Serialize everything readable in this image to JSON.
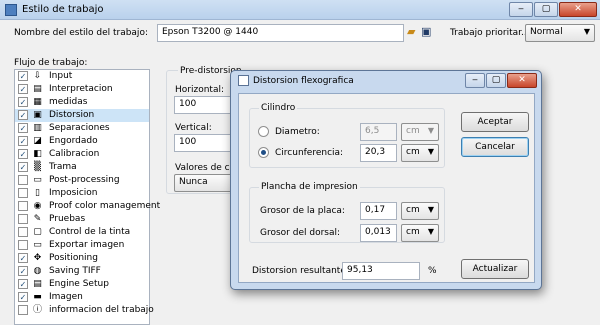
{
  "window": {
    "title": "Estilo de trabajo"
  },
  "header": {
    "style_name_label": "Nombre del estilo del trabajo:",
    "style_name_value": "Epson T3200 @ 1440",
    "priority_label": "Trabajo prioritar...",
    "priority_value": "Normal"
  },
  "workflow": {
    "label": "Flujo de trabajo:",
    "items": [
      {
        "label": "Input",
        "checked": true,
        "icon": "input-icon",
        "glyph": "⇩"
      },
      {
        "label": "Interpretacion",
        "checked": true,
        "icon": "interpretation-icon",
        "glyph": "▤"
      },
      {
        "label": "medidas",
        "checked": true,
        "icon": "measure-icon",
        "glyph": "▦"
      },
      {
        "label": "Distorsion",
        "checked": true,
        "icon": "distortion-icon",
        "glyph": "▣",
        "selected": true
      },
      {
        "label": "Separaciones",
        "checked": true,
        "icon": "separations-icon",
        "glyph": "▥"
      },
      {
        "label": "Engordado",
        "checked": true,
        "icon": "gain-icon",
        "glyph": "◪"
      },
      {
        "label": "Calibracion",
        "checked": true,
        "icon": "calibration-icon",
        "glyph": "◧"
      },
      {
        "label": "Trama",
        "checked": true,
        "icon": "screening-icon",
        "glyph": "▒"
      },
      {
        "label": "Post-processing",
        "checked": false,
        "icon": "post-processing-icon",
        "glyph": "▭"
      },
      {
        "label": "Imposicion",
        "checked": false,
        "icon": "imposition-icon",
        "glyph": "▯"
      },
      {
        "label": "Proof color management",
        "checked": false,
        "icon": "proof-color-icon",
        "glyph": "◉"
      },
      {
        "label": "Pruebas",
        "checked": false,
        "icon": "proofs-icon",
        "glyph": "✎"
      },
      {
        "label": "Control de la tinta",
        "checked": false,
        "icon": "ink-control-icon",
        "glyph": "▢"
      },
      {
        "label": "Exportar imagen",
        "checked": false,
        "icon": "export-image-icon",
        "glyph": "▭"
      },
      {
        "label": "Positioning",
        "checked": true,
        "icon": "positioning-icon",
        "glyph": "✥"
      },
      {
        "label": "Saving TIFF",
        "checked": true,
        "icon": "saving-tiff-icon",
        "glyph": "◍"
      },
      {
        "label": "Engine Setup",
        "checked": true,
        "icon": "engine-setup-icon",
        "glyph": "▤"
      },
      {
        "label": "Imagen",
        "checked": true,
        "icon": "image-icon",
        "glyph": "▬"
      },
      {
        "label": "informacion del trabajo",
        "checked": false,
        "icon": "info-icon",
        "glyph": "ⓘ"
      }
    ]
  },
  "predistortion": {
    "group_label": "Pre-distorsion",
    "horizontal_label": "Horizontal:",
    "horizontal_value": "100",
    "vertical_label": "Vertical:",
    "vertical_value": "100",
    "values_label": "Valores de ca",
    "values_select": "Nunca"
  },
  "dialog": {
    "title": "Distorsion flexografica",
    "cylinder_group": "Cilindro",
    "diameter_label": "Diametro:",
    "diameter_value": "6,5",
    "diameter_unit": "cm",
    "circumference_label": "Circunferencia:",
    "circumference_value": "20,3",
    "circumference_unit": "cm",
    "plate_group": "Plancha de impresion",
    "plate_thickness_label": "Grosor de la placa:",
    "plate_thickness_value": "0,17",
    "plate_thickness_unit": "cm",
    "backing_thickness_label": "Grosor del dorsal:",
    "backing_thickness_value": "0,013",
    "backing_thickness_unit": "cm",
    "result_label": "Distorsion resultante:",
    "result_value": "95,13",
    "result_unit": "%",
    "accept_button": "Aceptar",
    "cancel_button": "Cancelar",
    "update_button": "Actualizar"
  }
}
